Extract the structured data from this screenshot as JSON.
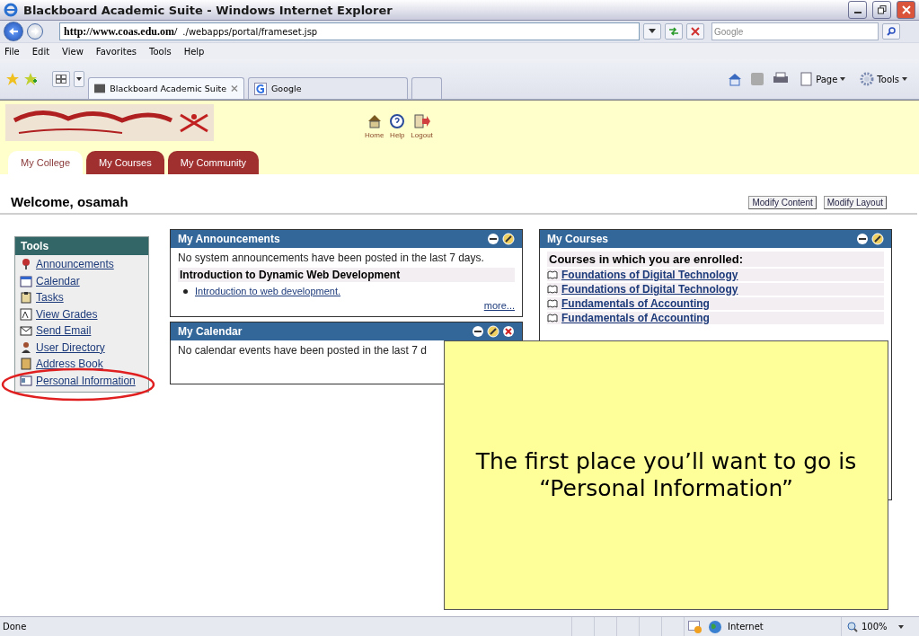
{
  "window": {
    "title": "Blackboard Academic Suite - Windows Internet Explorer"
  },
  "address_bar": {
    "host": "http://www.coas.edu.om/",
    "path": "./webapps/portal/frameset.jsp"
  },
  "search": {
    "placeholder": "Google"
  },
  "menu": [
    "File",
    "Edit",
    "View",
    "Favorites",
    "Tools",
    "Help"
  ],
  "browser_tabs": [
    {
      "label": "Blackboard Academic Suite",
      "selected": true,
      "kind": "bb"
    },
    {
      "label": "Google",
      "selected": false,
      "kind": "google"
    }
  ],
  "command_bar": [
    {
      "label": "Page",
      "kind": "page"
    },
    {
      "label": "Tools",
      "kind": "tools"
    }
  ],
  "header_links": [
    {
      "label": "Home",
      "kind": "home"
    },
    {
      "label": "Help",
      "kind": "help"
    },
    {
      "label": "Logout",
      "kind": "logout"
    }
  ],
  "portal_tabs": [
    {
      "label": "My College",
      "selected": true
    },
    {
      "label": "My Courses",
      "selected": false
    },
    {
      "label": "My Community",
      "selected": false
    }
  ],
  "welcome": "Welcome, osamah",
  "layout_buttons": [
    "Modify Content",
    "Modify Layout"
  ],
  "tools": {
    "title": "Tools",
    "items": [
      {
        "label": "Announcements",
        "kind": "pin"
      },
      {
        "label": "Calendar",
        "kind": "calendar"
      },
      {
        "label": "Tasks",
        "kind": "tasks"
      },
      {
        "label": "View Grades",
        "kind": "grades"
      },
      {
        "label": "Send Email",
        "kind": "email"
      },
      {
        "label": "User Directory",
        "kind": "user"
      },
      {
        "label": "Address Book",
        "kind": "book"
      },
      {
        "label": "Personal Information",
        "kind": "card"
      }
    ]
  },
  "announcements": {
    "title": "My Announcements",
    "message": "No system announcements have been posted in the last 7 days.",
    "course": "Introduction to Dynamic Web Development",
    "items": [
      "Introduction to web development."
    ],
    "more": "more..."
  },
  "calendar": {
    "title": "My Calendar",
    "message": "No calendar events have been posted in the last 7 d"
  },
  "courses": {
    "title": "My Courses",
    "heading": "Courses in which you are enrolled:",
    "items": [
      "Foundations of Digital Technology",
      "Foundations of Digital Technology",
      "Fundamentals of Accounting",
      "Fundamentals of Accounting"
    ]
  },
  "callout": {
    "text": "The first place you’ll want to go is “Personal Information”"
  },
  "status_bar": {
    "status": "Done",
    "zone": "Internet",
    "zoom": "100%"
  }
}
